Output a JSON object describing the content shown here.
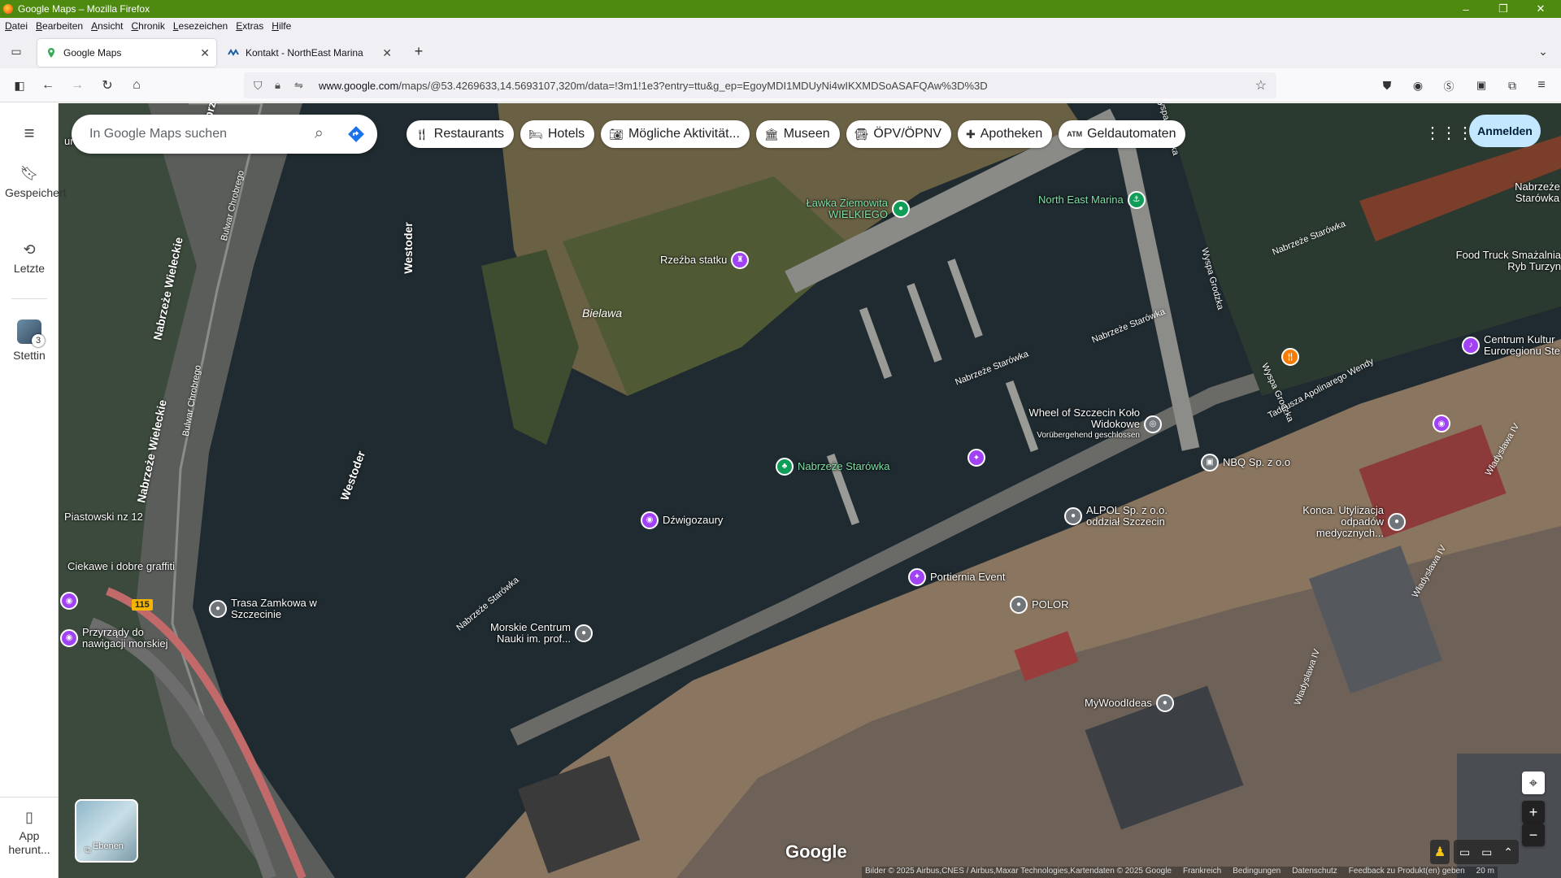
{
  "window": {
    "title": "Google Maps – Mozilla Firefox",
    "controls": {
      "minimize": "–",
      "maximize": "❐",
      "close": "✕"
    }
  },
  "menu": [
    "Datei",
    "Bearbeiten",
    "Ansicht",
    "Chronik",
    "Lesezeichen",
    "Extras",
    "Hilfe"
  ],
  "tabs": [
    {
      "title": "Google Maps",
      "active": true
    },
    {
      "title": "Kontakt - NorthEast Marina",
      "active": false
    }
  ],
  "navbar": {
    "url_domain": "www.google.com",
    "url_path": "/maps/@53.4269633,14.5693107,320m/data=!3m1!1e3?entry=ttu&g_ep=EgoyMDI1MDUyNi4wIKXMDSoASAFQAw%3D%3D"
  },
  "leftrail": {
    "saved": "Gespeichert",
    "recent": "Letzte",
    "stettin_badge": "3",
    "stettin": "Stettin",
    "app": "App herunt..."
  },
  "search": {
    "placeholder": "In Google Maps suchen"
  },
  "chips": [
    {
      "label": "Restaurants",
      "icon": "fork-knife-icon"
    },
    {
      "label": "Hotels",
      "icon": "bed-icon"
    },
    {
      "label": "Mögliche Aktivität...",
      "icon": "camera-icon"
    },
    {
      "label": "Museen",
      "icon": "museum-icon"
    },
    {
      "label": "ÖPV/ÖPNV",
      "icon": "bus-icon"
    },
    {
      "label": "Apotheken",
      "icon": "pharmacy-icon"
    },
    {
      "label": "Geldautomaten",
      "icon": "atm-icon"
    }
  ],
  "signin": "Anmelden",
  "pois": {
    "lawka": "Ławka Ziemowita WIELKIEGO",
    "northeast": "North East Marina",
    "rzezba": "Rzeźba statku",
    "bielawa": "Bielawa",
    "wheel": "Wheel of Szczecin Koło Widokowe",
    "wheel_note": "Vorübergehend geschlossen",
    "nabrzeze": "Nabrzeże Starówka",
    "dzwigozaury": "Dźwigozaury",
    "nbq": "NBQ Sp. z o.o",
    "alpol": "ALPOL Sp. z o.o. oddział Szczecin",
    "konca": "Konca. Utylizacja odpadów medycznych...",
    "portiernia": "Portiernia Event",
    "polor": "POLOR",
    "morskie": "Morskie Centrum Nauki im. prof...",
    "trasa": "Trasa Zamkowa w Szczecinie",
    "przyrzady": "Przyrządy do nawigacji morskiej",
    "ciekawe": "Ciekawe i dobre graffiti",
    "piastowski": "Piastowski nz 12",
    "food_truck": "Food Truck Smażalnia Ryb Turzyn",
    "centrum": "Centrum Kultur Euroregionu Ste",
    "nabrzeze_right": "Nabrzeże Starówka",
    "mywoodideas": "MyWoodIdeas",
    "urant": "urant",
    "route115": "115"
  },
  "roads": {
    "westoder1": "Westoder",
    "westoder2": "Westoder",
    "wieleckie1": "Nabrzeże Wieleckie",
    "wieleckie2": "Nabrzeże Wieleckie",
    "chrobrego1": "Bulwar Chrobrego",
    "chrobrego2": "Bulwar Chrobrego",
    "starowka1": "Nabrzeże Starówka",
    "starowka2": "Nabrzeże Starówka",
    "starowka3": "Nabrzeże Starówka",
    "starowka4": "Nabrzeże Starówka",
    "grodzka1": "Wyspa Grodzka",
    "grodzka2": "Wyspa Grodzka",
    "grodzka3": "Wyspa Grodzka",
    "wendy": "Tadeusza Apolinarego Wendy",
    "wladyslawa1": "Władysława IV",
    "wladyslawa2": "Władysława IV",
    "wladyslawa3": "Władysława IV",
    "nabrzeze_label": "Nabrzeże"
  },
  "bottom": {
    "layers": "Ebenen",
    "google": "Google",
    "attribution": [
      "Bilder © 2025 Airbus,CNES / Airbus,Maxar Technologies,Kartendaten © 2025 Google",
      "Frankreich",
      "Bedingungen",
      "Datenschutz",
      "Feedback zu Produkt(en) geben",
      "20 m"
    ]
  }
}
